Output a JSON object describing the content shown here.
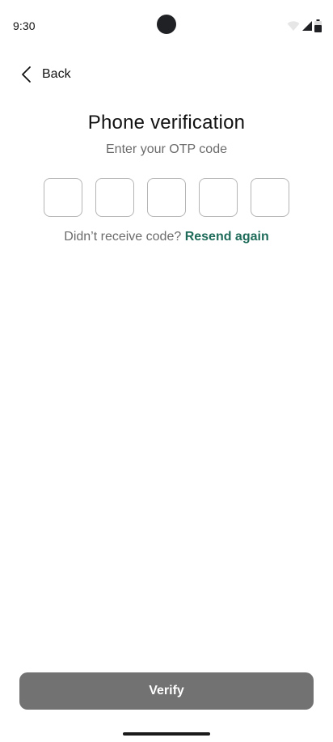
{
  "status_bar": {
    "time": "9:30",
    "icons": [
      "wifi-icon",
      "cellular-signal-icon",
      "battery-icon"
    ]
  },
  "header": {
    "back_label": "Back"
  },
  "content": {
    "title": "Phone verification",
    "subtitle": "Enter your OTP code",
    "otp_digits": [
      "",
      "",
      "",
      "",
      ""
    ],
    "resend_prompt": "Didn’t receive code?",
    "resend_link": "Resend again"
  },
  "footer": {
    "verify_label": "Verify"
  },
  "colors": {
    "accent_link": "#1e6b5a",
    "button_disabled": "#727272",
    "muted_text": "#6b6b6b"
  }
}
